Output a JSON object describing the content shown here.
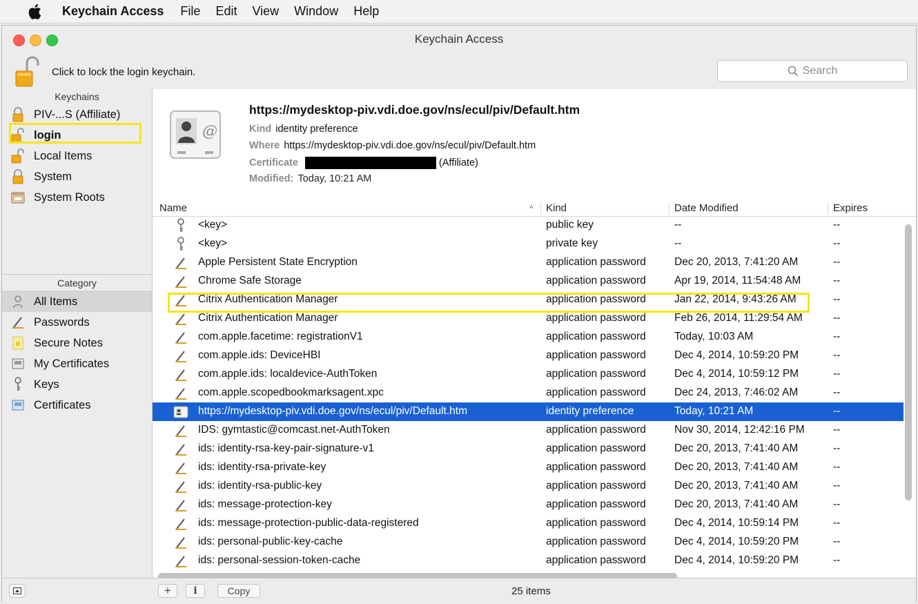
{
  "menubar": {
    "app": "Keychain Access",
    "items": [
      "File",
      "Edit",
      "View",
      "Window",
      "Help"
    ]
  },
  "window": {
    "title": "Keychain Access"
  },
  "toolbar": {
    "lock_text": "Click to lock the login keychain.",
    "search_placeholder": "Search"
  },
  "sidebar": {
    "keychains_header": "Keychains",
    "keychains": [
      {
        "label": "PIV-...S (Affiliate)",
        "icon": "lock-closed-icon"
      },
      {
        "label": "login",
        "icon": "lock-open-icon"
      },
      {
        "label": "Local Items",
        "icon": "lock-open-icon"
      },
      {
        "label": "System",
        "icon": "lock-closed-icon"
      },
      {
        "label": "System Roots",
        "icon": "folder-icon"
      }
    ],
    "category_header": "Category",
    "categories": [
      {
        "label": "All Items",
        "icon": "all-items-icon"
      },
      {
        "label": "Passwords",
        "icon": "pen-icon"
      },
      {
        "label": "Secure Notes",
        "icon": "note-icon"
      },
      {
        "label": "My Certificates",
        "icon": "my-certificate-icon"
      },
      {
        "label": "Keys",
        "icon": "key-icon"
      },
      {
        "label": "Certificates",
        "icon": "certificate-icon"
      }
    ]
  },
  "detail": {
    "name": "https://mydesktop-piv.vdi.doe.gov/ns/ecul/piv/Default.htm",
    "kind_label": "Kind",
    "kind_value": "identity preference",
    "where_label": "Where",
    "where_value": "https://mydesktop-piv.vdi.doe.gov/ns/ecul/piv/Default.htm",
    "cert_label": "Certificate",
    "cert_suffix": "(Affiliate)",
    "modified_label": "Modified:",
    "modified_value": "Today, 10:21 AM"
  },
  "table": {
    "columns": [
      "Name",
      "Kind",
      "Date Modified",
      "Expires"
    ],
    "sort_indicator": "^",
    "rows": [
      {
        "name": "<key>",
        "kind": "public key",
        "date": "--",
        "expires": "--",
        "icon": "key-icon"
      },
      {
        "name": "<key>",
        "kind": "private key",
        "date": "--",
        "expires": "--",
        "icon": "key-icon"
      },
      {
        "name": "Apple Persistent State Encryption",
        "kind": "application password",
        "date": "Dec 20, 2013, 7:41:20 AM",
        "expires": "--",
        "icon": "pen-icon"
      },
      {
        "name": "Chrome Safe Storage",
        "kind": "application password",
        "date": "Apr 19, 2014, 11:54:48 AM",
        "expires": "--",
        "icon": "pen-icon"
      },
      {
        "name": "Citrix Authentication Manager",
        "kind": "application password",
        "date": "Jan 22, 2014, 9:43:26 AM",
        "expires": "--",
        "icon": "pen-icon"
      },
      {
        "name": "Citrix Authentication Manager",
        "kind": "application password",
        "date": "Feb 26, 2014, 11:29:54 AM",
        "expires": "--",
        "icon": "pen-icon"
      },
      {
        "name": "com.apple.facetime: registrationV1",
        "kind": "application password",
        "date": "Today, 10:03 AM",
        "expires": "--",
        "icon": "pen-icon"
      },
      {
        "name": "com.apple.ids: DeviceHBI",
        "kind": "application password",
        "date": "Dec 4, 2014, 10:59:20 PM",
        "expires": "--",
        "icon": "pen-icon"
      },
      {
        "name": "com.apple.ids: localdevice-AuthToken",
        "kind": "application password",
        "date": "Dec 4, 2014, 10:59:12 PM",
        "expires": "--",
        "icon": "pen-icon"
      },
      {
        "name": "com.apple.scopedbookmarksagent.xpc",
        "kind": "application password",
        "date": "Dec 24, 2013, 7:46:02 AM",
        "expires": "--",
        "icon": "pen-icon"
      },
      {
        "name": "https://mydesktop-piv.vdi.doe.gov/ns/ecul/piv/Default.htm",
        "kind": "identity preference",
        "date": "Today, 10:21 AM",
        "expires": "--",
        "icon": "identity-icon"
      },
      {
        "name": "IDS: gymtastic@comcast.net-AuthToken",
        "kind": "application password",
        "date": "Nov 30, 2014, 12:42:16 PM",
        "expires": "--",
        "icon": "pen-icon"
      },
      {
        "name": "ids: identity-rsa-key-pair-signature-v1",
        "kind": "application password",
        "date": "Dec 20, 2013, 7:41:40 AM",
        "expires": "--",
        "icon": "pen-icon"
      },
      {
        "name": "ids: identity-rsa-private-key",
        "kind": "application password",
        "date": "Dec 20, 2013, 7:41:40 AM",
        "expires": "--",
        "icon": "pen-icon"
      },
      {
        "name": "ids: identity-rsa-public-key",
        "kind": "application password",
        "date": "Dec 20, 2013, 7:41:40 AM",
        "expires": "--",
        "icon": "pen-icon"
      },
      {
        "name": "ids: message-protection-key",
        "kind": "application password",
        "date": "Dec 20, 2013, 7:41:40 AM",
        "expires": "--",
        "icon": "pen-icon"
      },
      {
        "name": "ids: message-protection-public-data-registered",
        "kind": "application password",
        "date": "Dec 4, 2014, 10:59:14 PM",
        "expires": "--",
        "icon": "pen-icon"
      },
      {
        "name": "ids: personal-public-key-cache",
        "kind": "application password",
        "date": "Dec 4, 2014, 10:59:20 PM",
        "expires": "--",
        "icon": "pen-icon"
      },
      {
        "name": "ids: personal-session-token-cache",
        "kind": "application password",
        "date": "Dec 4, 2014, 10:59:20 PM",
        "expires": "--",
        "icon": "pen-icon"
      }
    ]
  },
  "bottom": {
    "add_label": "+",
    "info_label": "i",
    "copy_label": "Copy",
    "status": "25 items"
  },
  "colors": {
    "selection": "#1961d2",
    "highlight_box": "#f5e51b"
  }
}
